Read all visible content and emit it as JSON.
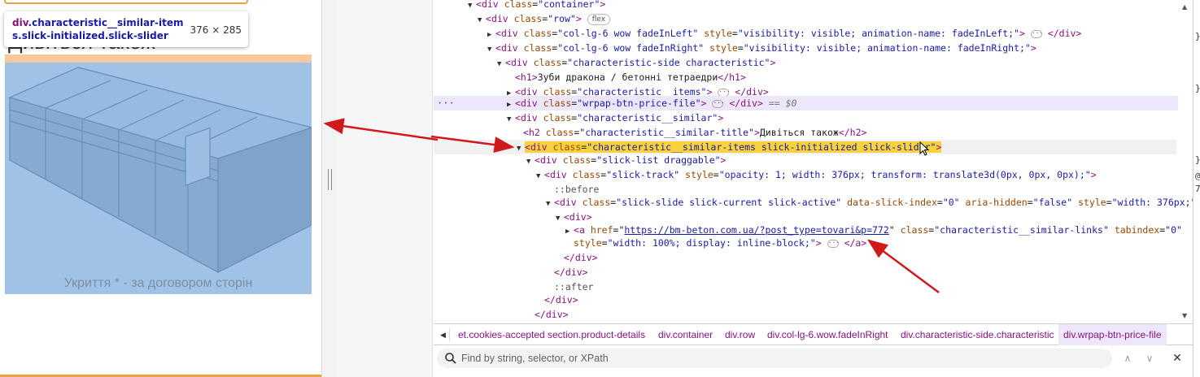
{
  "preview": {
    "heading_peek": "Дивіться також",
    "caption": "Укриття * - за договором сторін"
  },
  "tooltip": {
    "tag": "div",
    "classes": ".characteristic__similar-items.slick-initialized.slick-slider",
    "size": "376 × 285"
  },
  "dom": {
    "l1": {
      "tag": "div",
      "class_attr": "class",
      "class_val": "\"container\""
    },
    "l2": {
      "tag": "div",
      "class_val": "\"row\"",
      "badge": "flex"
    },
    "l3": {
      "tag": "div",
      "class_val": "\"col-lg-6 wow fadeInLeft\"",
      "style_attr": "style",
      "style_val": "\"visibility: visible; animation-name: fadeInLeft;\"",
      "close": "</div>"
    },
    "l4": {
      "tag": "div",
      "class_val": "\"col-lg-6 wow fadeInRight\"",
      "style_val": "\"visibility: visible; animation-name: fadeInRight;\""
    },
    "l5": {
      "tag": "div",
      "class_val": "\"characteristic-side characteristic\""
    },
    "l6": {
      "open": "<h1>",
      "text": "Зуби дракона / бетонні тетраедри",
      "close": "</h1>"
    },
    "l7": {
      "tag": "div",
      "class_val": "\"characteristic__items\"",
      "close": "</div>"
    },
    "l8": {
      "tag": "div",
      "class_val": "\"wrpap-btn-price-file\"",
      "close": "</div>",
      "eq": "== $0"
    },
    "l9": {
      "tag": "div",
      "class_val": "\"characteristic__similar\""
    },
    "l10": {
      "tag": "h2",
      "class_val": "\"characteristic__similar-title\"",
      "text": "Дивіться також",
      "close": "</h2>"
    },
    "l11": {
      "tag": "div",
      "class_val": "\"characteristic__similar-items slick-initialized slick-slider\""
    },
    "l12": {
      "tag": "div",
      "class_val": "\"slick-list draggable\""
    },
    "l13": {
      "tag": "div",
      "class_val": "\"slick-track\"",
      "style_val": "\"opacity: 1; width: 376px; transform: translate3d(0px, 0px, 0px);\""
    },
    "l14": {
      "text": "::before"
    },
    "l15": {
      "tag": "div",
      "class_val": "\"slick-slide slick-current slick-active\"",
      "a1": "data-slick-index",
      "v1": "\"0\"",
      "a2": "aria-hidden",
      "v2": "\"false\"",
      "style_val": "\"width: 376px;\""
    },
    "l16": {
      "open": "<div>"
    },
    "l17": {
      "tag": "a",
      "href_attr": "href",
      "href_val": "https://bm-beton.com.ua/?post_type=tovari&p=772",
      "class_val": "\"characteristic__similar-links\"",
      "a1": "tabindex",
      "v1": "\"0\""
    },
    "l18": {
      "style_attr": "style",
      "style_val": "\"width: 100%; display: inline-block;\"",
      "close": "</a>"
    },
    "l19": {
      "close": "</div>"
    },
    "l20": {
      "close": "</div>"
    },
    "l21": {
      "text": "::after"
    },
    "l22": {
      "close": "</div>"
    },
    "l23": {
      "close": "</div>"
    }
  },
  "breadcrumbs": [
    "et.cookies-accepted",
    "section.product-details",
    "div.container",
    "div.row",
    "div.col-lg-6.wow.fadeInRight",
    "div.characteristic-side.characteristic",
    "div.wrpap-btn-price-file"
  ],
  "search": {
    "placeholder": "Find by string, selector, or XPath"
  },
  "styles_strip": {
    "c1": "}",
    "c2": "}",
    "c3": "}",
    "c4": "@",
    "c5": "7"
  },
  "colors": {
    "tag": "#881280",
    "attr_name": "#994500",
    "attr_value": "#1a1aa6",
    "highlight": "#f8d23c",
    "hover_row": "#eee6fa",
    "slider_overlay": "#9fc2e6",
    "margin_overlay": "#f7c89b",
    "arrow": "#d0191b"
  }
}
